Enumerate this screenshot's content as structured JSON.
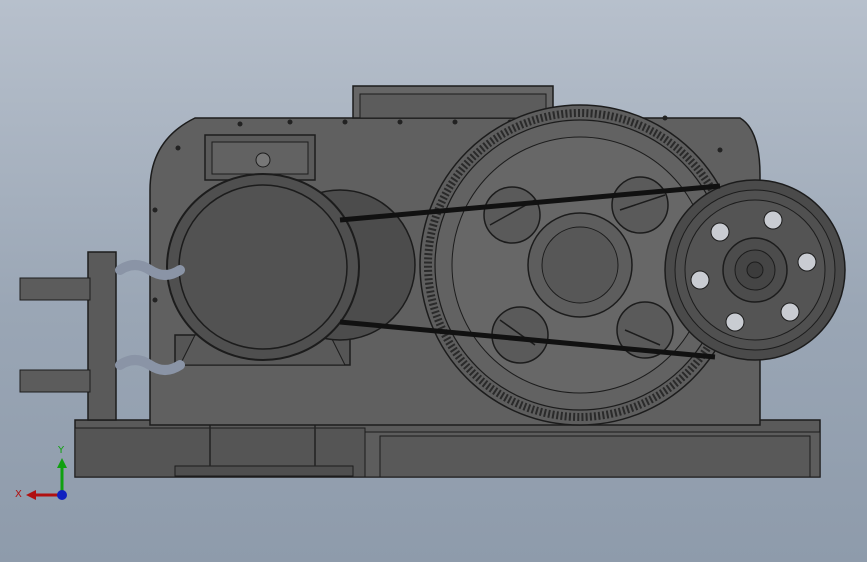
{
  "viewport": {
    "background_top": "#b7c0cc",
    "background_bottom": "#8e9bab"
  },
  "model": {
    "body_color": "#5f5f5f",
    "body_dark": "#3f3f3f",
    "gear_color": "#676767",
    "pulley_color": "#4c4c4c",
    "belt_color": "#111111",
    "spring_color": "#8a94a6",
    "motor_color": "#4a4a4a"
  },
  "triad": {
    "x_label": "X",
    "y_label": "Y",
    "x_color": "#b01010",
    "y_color": "#10a010",
    "z_color": "#1020c0",
    "icon": "coordinate-triad-icon"
  }
}
